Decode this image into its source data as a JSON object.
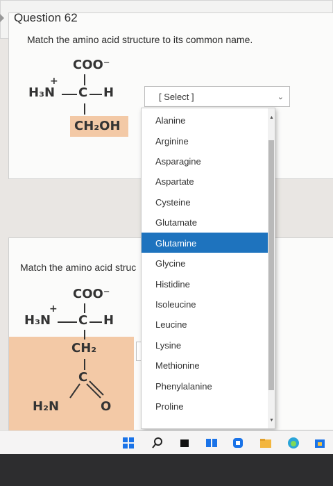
{
  "question1": {
    "prompt": "Match the amino acid structure to its common name.",
    "molecule": {
      "top": "COO⁻",
      "plus": "+",
      "left": "H₃N",
      "dash": "—",
      "center": "C",
      "right": "—H",
      "side_chain": "CH₂OH"
    }
  },
  "question62": {
    "label": "Question 62",
    "prompt": "Match the amino acid struc",
    "molecule": {
      "top": "COO⁻",
      "plus": "+",
      "left": "H₃N",
      "dash": "—",
      "center": "C",
      "right": "—H",
      "ch2": "CH₂",
      "c2": "C",
      "amide": "H₂N",
      "oxygen": "O"
    }
  },
  "select": {
    "value": "[ Select ]"
  },
  "dropdown": {
    "options": [
      "Alanine",
      "Arginine",
      "Asparagine",
      "Aspartate",
      "Cysteine",
      "Glutamate",
      "Glutamine",
      "Glycine",
      "Histidine",
      "Isoleucine",
      "Leucine",
      "Lysine",
      "Methionine",
      "Phenylalanine",
      "Proline"
    ],
    "highlighted": "Glutamine",
    "highlight_color": "#1e73be"
  },
  "taskbar": {
    "icons": [
      "windows-start-icon",
      "search-icon",
      "task-view-icon",
      "widgets-icon",
      "chat-icon",
      "file-explorer-icon",
      "edge-browser-icon",
      "store-icon"
    ]
  }
}
